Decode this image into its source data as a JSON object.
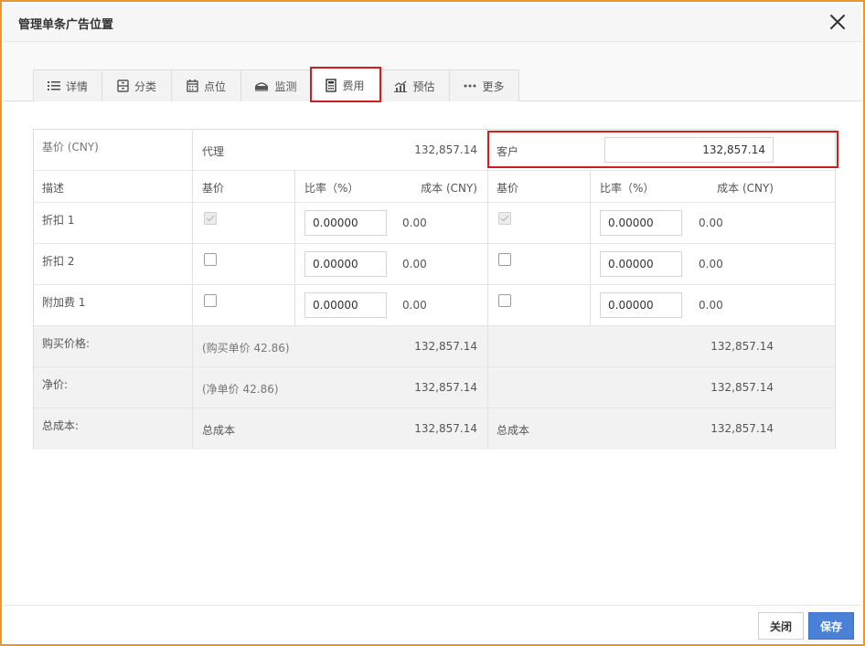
{
  "dialog": {
    "title": "管理单条广告位置",
    "close_icon": "close-icon"
  },
  "tabs": [
    {
      "label": "详情",
      "icon": "list-icon"
    },
    {
      "label": "分类",
      "icon": "cabinet-icon"
    },
    {
      "label": "点位",
      "icon": "calendar-icon"
    },
    {
      "label": "监测",
      "icon": "monitor-icon"
    },
    {
      "label": "费用",
      "icon": "calculator-icon",
      "active": true
    },
    {
      "label": "预估",
      "icon": "chart-icon"
    },
    {
      "label": "更多",
      "icon": "more-icon"
    }
  ],
  "table": {
    "base_row": {
      "label": "基价 (CNY)",
      "agent_label": "代理",
      "agent_value": "132,857.14",
      "customer_label": "客户",
      "customer_value": "132,857.14"
    },
    "headers": {
      "desc": "描述",
      "base": "基价",
      "rate": "比率（%）",
      "cost": "成本 (CNY)",
      "base2": "基价",
      "rate2": "比率（%）",
      "cost2": "成本 (CNY)"
    },
    "items": [
      {
        "label": "折扣 1",
        "agent_checked": true,
        "agent_disabled": true,
        "agent_rate": "0.00000",
        "agent_cost": "0.00",
        "cust_checked": true,
        "cust_disabled": true,
        "cust_rate": "0.00000",
        "cust_cost": "0.00"
      },
      {
        "label": "折扣 2",
        "agent_checked": false,
        "agent_disabled": false,
        "agent_rate": "0.00000",
        "agent_cost": "0.00",
        "cust_checked": false,
        "cust_disabled": false,
        "cust_rate": "0.00000",
        "cust_cost": "0.00"
      },
      {
        "label": "附加费 1",
        "agent_checked": false,
        "agent_disabled": false,
        "agent_rate": "0.00000",
        "agent_cost": "0.00",
        "cust_checked": false,
        "cust_disabled": false,
        "cust_rate": "0.00000",
        "cust_cost": "0.00"
      }
    ],
    "purchase": {
      "label": "购买价格:",
      "agent_note": "(购买单价 42.86)",
      "agent_value": "132,857.14",
      "cust_value": "132,857.14"
    },
    "net": {
      "label": "净价:",
      "agent_note": "(净单价 42.86)",
      "agent_value": "132,857.14",
      "cust_value": "132,857.14"
    },
    "total": {
      "label": "总成本:",
      "agent_label": "总成本",
      "agent_value": "132,857.14",
      "cust_label": "总成本",
      "cust_value": "132,857.14"
    }
  },
  "footer": {
    "close_label": "关闭",
    "save_label": "保存"
  }
}
